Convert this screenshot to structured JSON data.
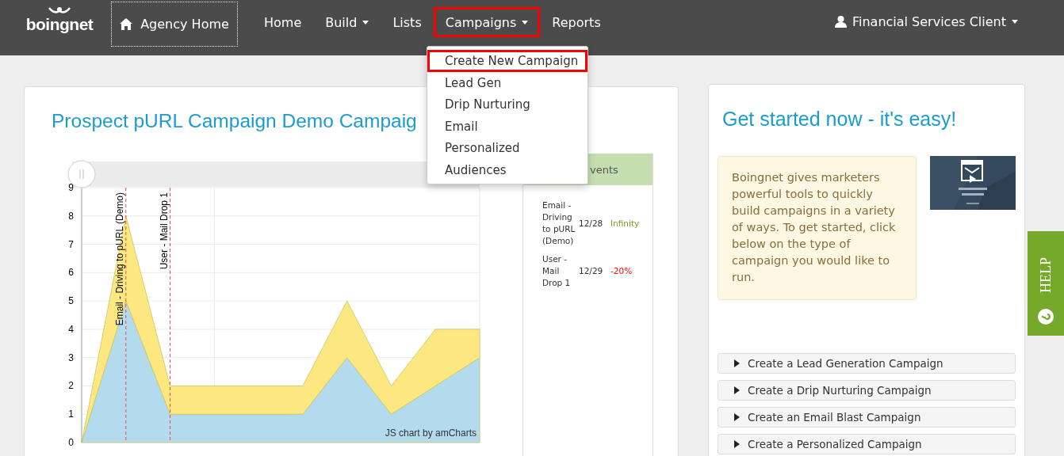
{
  "navbar": {
    "logo": "boingnet",
    "agency_home": "Agency Home",
    "items": [
      {
        "label": "Home",
        "dropdown": false,
        "highlighted": false
      },
      {
        "label": "Build",
        "dropdown": true,
        "highlighted": false
      },
      {
        "label": "Lists",
        "dropdown": false,
        "highlighted": false
      },
      {
        "label": "Campaigns",
        "dropdown": true,
        "highlighted": true
      },
      {
        "label": "Reports",
        "dropdown": false,
        "highlighted": false
      }
    ],
    "user": {
      "label": "Financial Services Client",
      "dropdown": true
    }
  },
  "campaigns_menu": {
    "expanded": true,
    "items": [
      {
        "label": "Create New Campaign",
        "highlighted": true
      },
      {
        "label": "Lead Gen",
        "highlighted": false
      },
      {
        "label": "Drip Nurturing",
        "highlighted": false
      },
      {
        "label": "Email",
        "highlighted": false
      },
      {
        "label": "Personalized",
        "highlighted": false
      },
      {
        "label": "Audiences",
        "highlighted": false
      }
    ]
  },
  "campaign_card": {
    "title": "Prospect pURL Campaign Demo Campaig",
    "chart_data": {
      "type": "area",
      "stacked": true,
      "grid": true,
      "ylim": [
        0,
        9
      ],
      "yticks": [
        0,
        1,
        2,
        3,
        4,
        5,
        6,
        7,
        8,
        9
      ],
      "series": [
        {
          "color": "#b3dbed",
          "values": [
            0,
            5,
            1,
            1,
            1,
            1,
            3,
            1,
            2,
            3
          ]
        },
        {
          "color": "#fde781",
          "values": [
            0,
            3,
            1,
            1,
            1,
            1,
            2,
            1,
            2,
            1
          ]
        }
      ]
    },
    "event_markers": [
      {
        "label": "Email - Driving to pURL (Demo)"
      },
      {
        "label": "User - Mail Drop 1"
      }
    ],
    "chart_credit": "JS chart by amCharts",
    "events": {
      "header": "vents",
      "rows": [
        {
          "name": "Email - Driving to pURL (Demo)",
          "date": "12/28",
          "change": "Infinity",
          "color": "#7a9a1c"
        },
        {
          "name": "User - Mail Drop 1",
          "date": "12/29",
          "change": "-20%",
          "color": "#ff0000"
        }
      ]
    }
  },
  "start_card": {
    "title": "Get started now - it's easy!",
    "info": "Boingnet gives marketers powerful tools to quickly build campaigns in a variety of ways. To get started, click below on the type of campaign you would like to run.",
    "options": [
      {
        "label": "Create a Lead Generation Campaign",
        "expanded": false
      },
      {
        "label": "Create a Drip Nurturing Campaign",
        "expanded": false
      },
      {
        "label": "Create an Email Blast Campaign",
        "expanded": false
      },
      {
        "label": "Create a Personalized Campaign",
        "expanded": false
      }
    ]
  },
  "help_tab": {
    "label": "HELP"
  }
}
